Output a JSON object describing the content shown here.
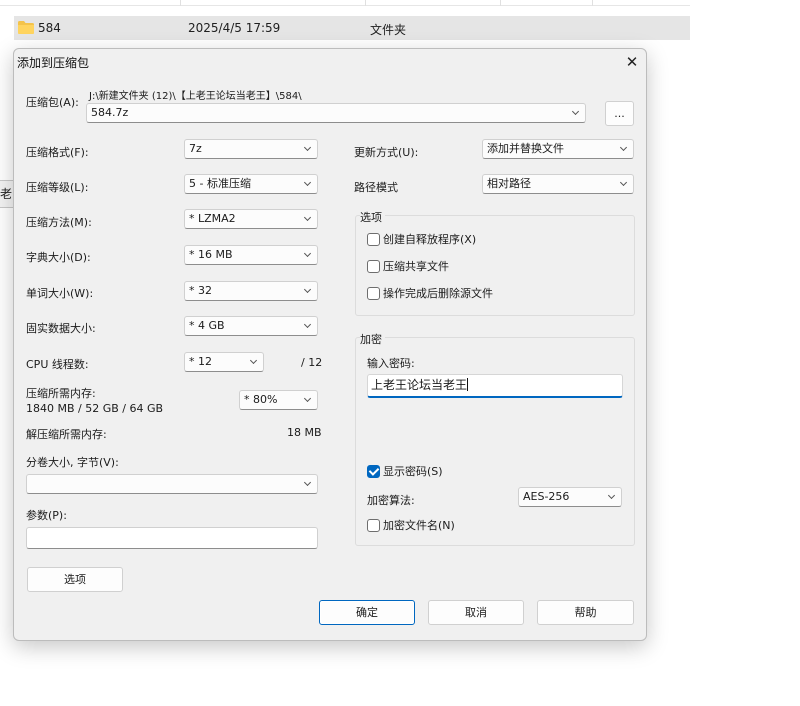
{
  "explorer": {
    "row": {
      "name": "584",
      "date": "2025/4/5 17:59",
      "type": "文件夹"
    },
    "left_tab": "老"
  },
  "dialog": {
    "title": "添加到压缩包",
    "archive": {
      "label": "压缩包(A):",
      "path": "J:\\新建文件夹 (12)\\【上老王论坛当老王】\\584\\",
      "value": "584.7z",
      "browse": "..."
    },
    "format": {
      "label": "压缩格式(F):",
      "value": "7z"
    },
    "level": {
      "label": "压缩等级(L):",
      "value": "5 - 标准压缩"
    },
    "method": {
      "label": "压缩方法(M):",
      "value": "*  LZMA2"
    },
    "dict": {
      "label": "字典大小(D):",
      "value": "*  16 MB"
    },
    "word": {
      "label": "单词大小(W):",
      "value": "*  32"
    },
    "solid": {
      "label": "固实数据大小:",
      "value": "*  4 GB"
    },
    "threads": {
      "label": "CPU 线程数:",
      "value": "*  12",
      "max": "/ 12"
    },
    "mem_compress": {
      "label": "压缩所需内存:",
      "detail": "1840 MB / 52 GB / 64 GB",
      "value": "*  80%"
    },
    "mem_decompress": {
      "label": "解压缩所需内存:",
      "value": "18 MB"
    },
    "split": {
      "label": "分卷大小, 字节(V):",
      "value": ""
    },
    "params": {
      "label": "参数(P):",
      "value": ""
    },
    "options_button": "选项",
    "update": {
      "label": "更新方式(U):",
      "value": "添加并替换文件"
    },
    "pathmode": {
      "label": "路径模式",
      "value": "相对路径"
    },
    "options_group": {
      "title": "选项",
      "sfx": "创建自释放程序(X)",
      "shared": "压缩共享文件",
      "delete": "操作完成后删除源文件"
    },
    "encryption": {
      "title": "加密",
      "enter_label": "输入密码:",
      "password": "上老王论坛当老王",
      "show_password": "显示密码(S)",
      "method_label": "加密算法:",
      "method_value": "AES-256",
      "encrypt_names": "加密文件名(N)"
    },
    "buttons": {
      "ok": "确定",
      "cancel": "取消",
      "help": "帮助"
    }
  }
}
